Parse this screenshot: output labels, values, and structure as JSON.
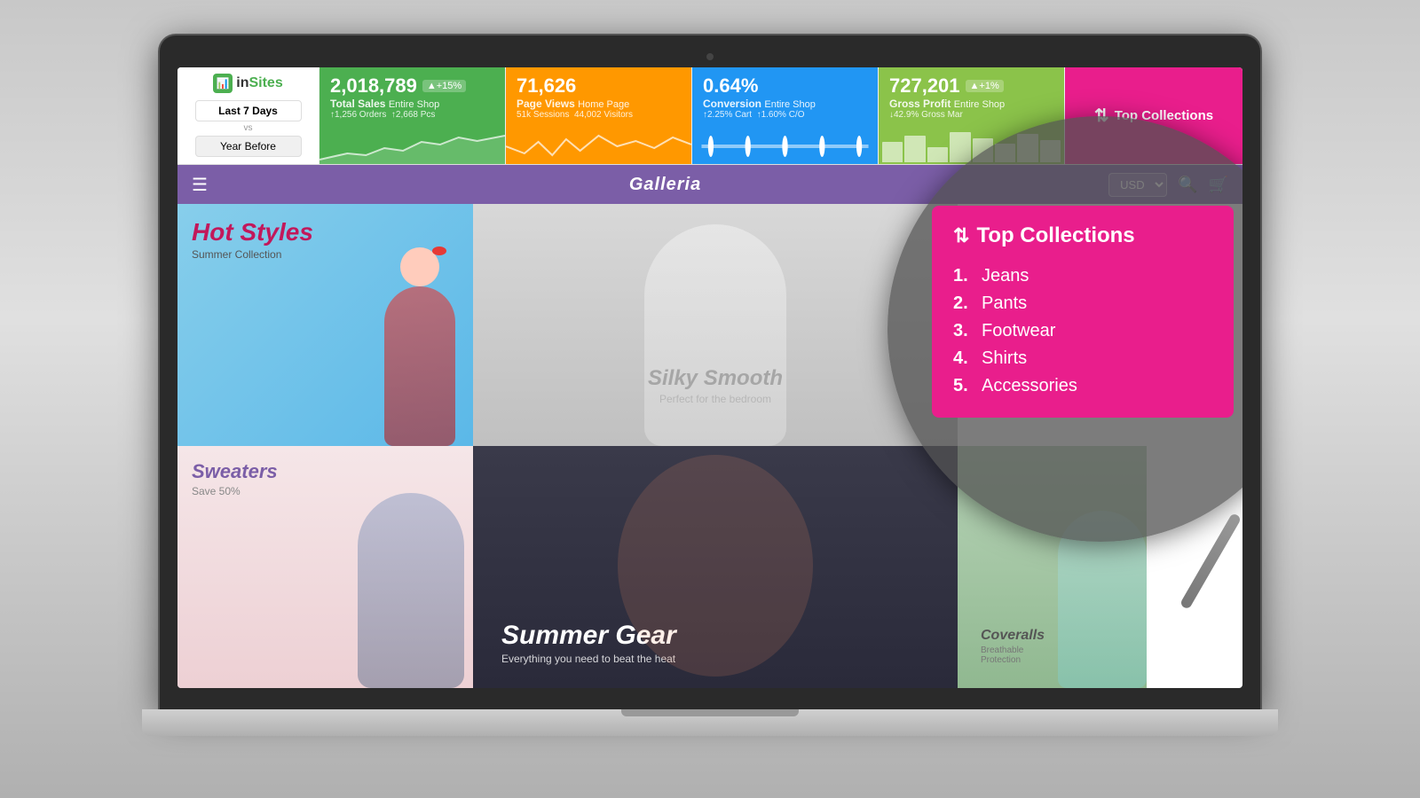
{
  "laptop": {
    "camera_label": "camera"
  },
  "analytics": {
    "brand": "inSites",
    "brand_icon": "📊",
    "date_btn_last": "Last 7 Days",
    "date_btn_vs": "vs",
    "date_btn_year": "Year Before",
    "stats": [
      {
        "id": "total-sales",
        "value": "2,018,789",
        "badge": "▲+15%",
        "label": "Total Sales",
        "sublabel": "Entire Shop",
        "sub2": "↑1,256 Orders  ↑2,668 Pcs",
        "color": "green"
      },
      {
        "id": "page-views",
        "value": "71,626",
        "badge": "",
        "label": "Page Views",
        "sublabel": "Home Page",
        "sub2": "51k Sessions  44,002 Visitors",
        "color": "orange"
      },
      {
        "id": "conversion",
        "value": "0.64%",
        "badge": "",
        "label": "Conversion",
        "sublabel": "Entire Shop",
        "sub2": "↑2.25% Cart  ↑1.60% C/O",
        "color": "blue"
      },
      {
        "id": "gross-profit",
        "value": "727,201",
        "badge": "▲+1%",
        "label": "Gross Profit",
        "sublabel": "Entire Shop",
        "sub2": "↓42.9% Gross Mar",
        "color": "lime"
      }
    ],
    "top_collections_label": "Top Collections"
  },
  "store": {
    "nav_name": "Galleria",
    "currency": "USD",
    "menu_icon": "☰",
    "search_icon": "🔍",
    "cart_icon": "🛒"
  },
  "banners": [
    {
      "id": "hot-styles",
      "title": "Hot Styles",
      "subtitle": "Summer Collection",
      "style": "hot"
    },
    {
      "id": "silky-smooth",
      "title": "Silky Smooth",
      "subtitle": "Perfect for the bedroom",
      "style": "silky"
    },
    {
      "id": "sweaters",
      "title": "Sweaters",
      "subtitle": "Save 50%",
      "style": "sweater"
    },
    {
      "id": "summer-gear",
      "title": "Summer Gear",
      "subtitle": "Everything you need to beat the heat",
      "style": "summer"
    },
    {
      "id": "coveralls",
      "title": "Coveralls",
      "subtitle": "Breathable Protection",
      "style": "cover"
    }
  ],
  "top_collections_popup": {
    "title": "Top Collections",
    "icon": "↕",
    "items": [
      {
        "num": "1.",
        "name": "Jeans"
      },
      {
        "num": "2.",
        "name": "Pants"
      },
      {
        "num": "3.",
        "name": "Footwear"
      },
      {
        "num": "4.",
        "name": "Shirts"
      },
      {
        "num": "5.",
        "name": "Accessories"
      }
    ]
  }
}
